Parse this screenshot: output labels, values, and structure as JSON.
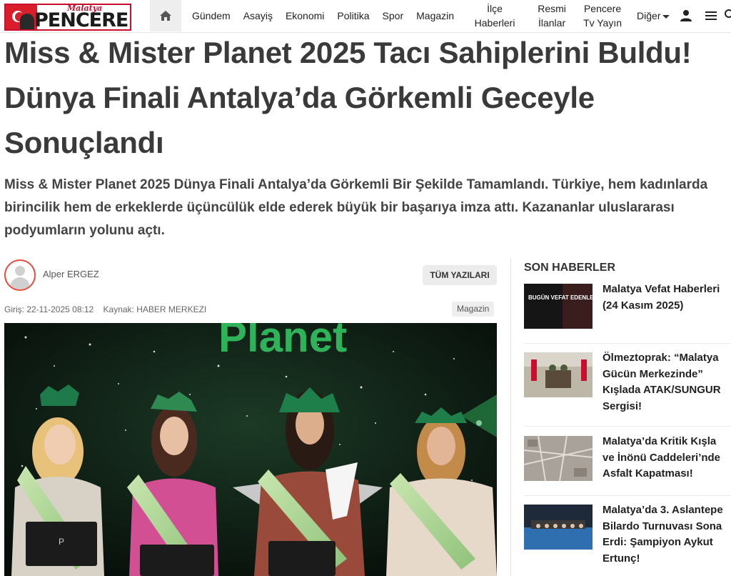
{
  "header": {
    "logo": {
      "city": "Malatya",
      "brand": "PENCERE"
    },
    "home_icon": "home-icon",
    "nav": [
      {
        "label": "Gündem"
      },
      {
        "label": "Asayiş"
      },
      {
        "label": "Ekonomi"
      },
      {
        "label": "Politika"
      },
      {
        "label": "Spor"
      },
      {
        "label": "Magazin"
      },
      {
        "label": "İlçe Haberleri"
      },
      {
        "label": "Resmi İlanlar"
      },
      {
        "label": "Pencere Tv Yayın"
      },
      {
        "label": "Diğer"
      }
    ],
    "icons": [
      "user-icon",
      "hamburger-menu-icon",
      "search-icon"
    ]
  },
  "article": {
    "title": "Miss & Mister Planet 2025 Tacı Sahiplerini Buldu! Dünya Finali Antalya’da Görkemli Geceyle Sonuçlandı",
    "spot": "Miss & Mister Planet 2025 Dünya Finali Antalya’da Görkemli Bir Şekilde Tamamlandı. Türkiye, hem kadınlarda birincilik hem de erkeklerde üçüncülük elde ederek büyük bir başarıya imza attı. Kazananlar uluslararası podyumların yolunu açtı.",
    "author": "Alper ERGEZ",
    "all_posts_label": "TÜM YAZILARI",
    "published": "Giriş: 22-11-2025 08:12",
    "source": "Kaynak: HABER MERKEZI",
    "category": "Magazin",
    "image_text": "Planet"
  },
  "sidebar": {
    "title": "SON HABERLER",
    "items": [
      {
        "headline": "Malatya Vefat Haberleri (24 Kasım 2025)",
        "thumb_text": "BUGÜN VEFAT EDENLER"
      },
      {
        "headline": "Ölmeztoprak: “Malatya Gücün Merkezinde” Kışlada ATAK/SUNGUR Sergisi!"
      },
      {
        "headline": "Malatya’da Kritik Kışla ve İnönü Caddeleri’nde Asfalt Kapatması!"
      },
      {
        "headline": "Malatya’da 3. Aslantepe Bilardo Turnuvası Sona Erdi: Şampiyon Aykut Ertunç!"
      }
    ]
  },
  "colors": {
    "brand_red": "#c8102e",
    "text_dark": "#3a3a3a",
    "stage_green": "#1a8a4a"
  }
}
